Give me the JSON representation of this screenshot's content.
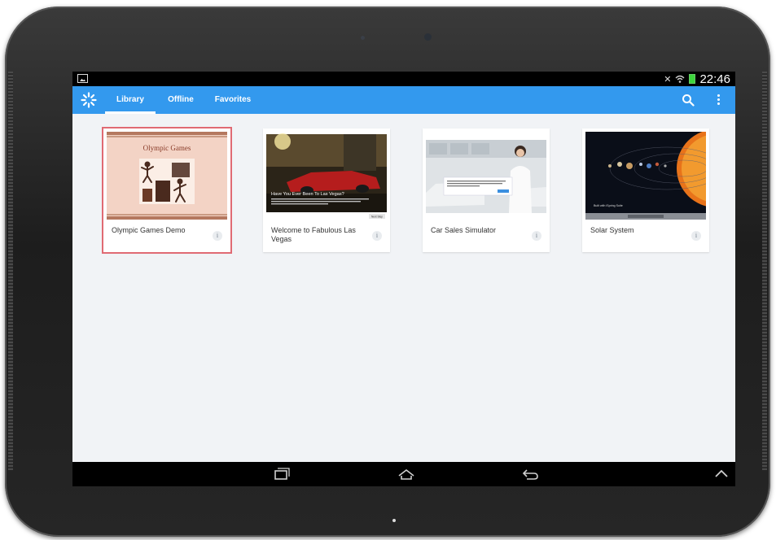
{
  "status_bar": {
    "time": "22:46"
  },
  "action_bar": {
    "tabs": [
      {
        "label": "Library",
        "active": true
      },
      {
        "label": "Offline",
        "active": false
      },
      {
        "label": "Favorites",
        "active": false
      }
    ],
    "accent_color": "#3399ee"
  },
  "library": {
    "items": [
      {
        "title": "Olympic Games Demo",
        "selected": true,
        "thumbnail_title": "Olympic Games"
      },
      {
        "title": "Welcome to Fabulous Las Vegas",
        "selected": false,
        "thumbnail_title": "Have You Ever Been To Las Vegas?",
        "thumbnail_button": "Next Step"
      },
      {
        "title": "Car Sales Simulator",
        "selected": false
      },
      {
        "title": "Solar System",
        "selected": false,
        "thumbnail_caption": "Built with iSpring Suite"
      }
    ],
    "info_glyph": "i"
  },
  "icons": {
    "logo": "spark-logo-icon",
    "search": "search-icon",
    "overflow": "overflow-menu-icon",
    "nav": [
      "recent-apps-icon",
      "home-icon",
      "back-icon",
      "collapse-icon"
    ]
  }
}
